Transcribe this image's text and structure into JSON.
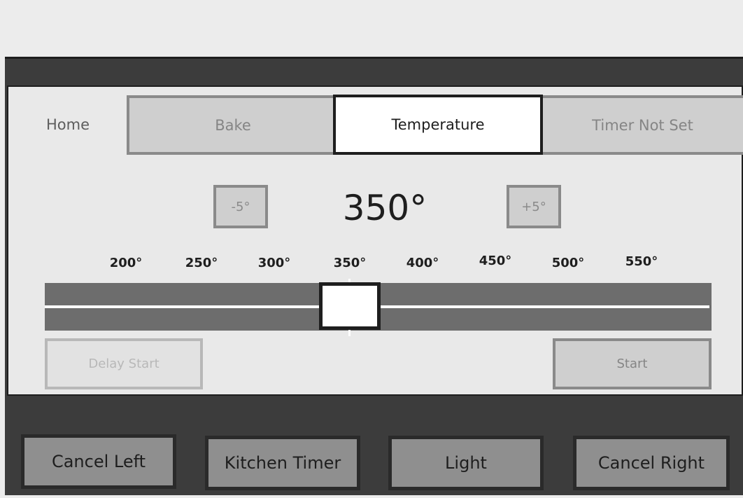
{
  "nav": {
    "home_label": "Home",
    "tabs": [
      {
        "label": "Bake"
      },
      {
        "label": "Temperature",
        "active": true
      },
      {
        "label": "Timer Not Set"
      }
    ]
  },
  "temperature": {
    "value": "350°",
    "decrement_label": "-5°",
    "increment_label": "+5°",
    "ticks": [
      "200°",
      "250°",
      "300°",
      "350°",
      "400°",
      "450°",
      "500°",
      "550°"
    ],
    "slider_position_fraction": 0.43
  },
  "actions": {
    "delay_start_label": "Delay Start",
    "start_label": "Start"
  },
  "hardware_buttons": {
    "cancel_left": "Cancel Left",
    "kitchen_timer": "Kitchen Timer",
    "light": "Light",
    "cancel_right": "Cancel Right"
  },
  "colors": {
    "frame": "#3c3c3c",
    "screen": "#e9e9e9",
    "active_tab": "#ffffff",
    "inactive_tab": "#cfcfcf",
    "slider_track": "#6d6d6d"
  }
}
